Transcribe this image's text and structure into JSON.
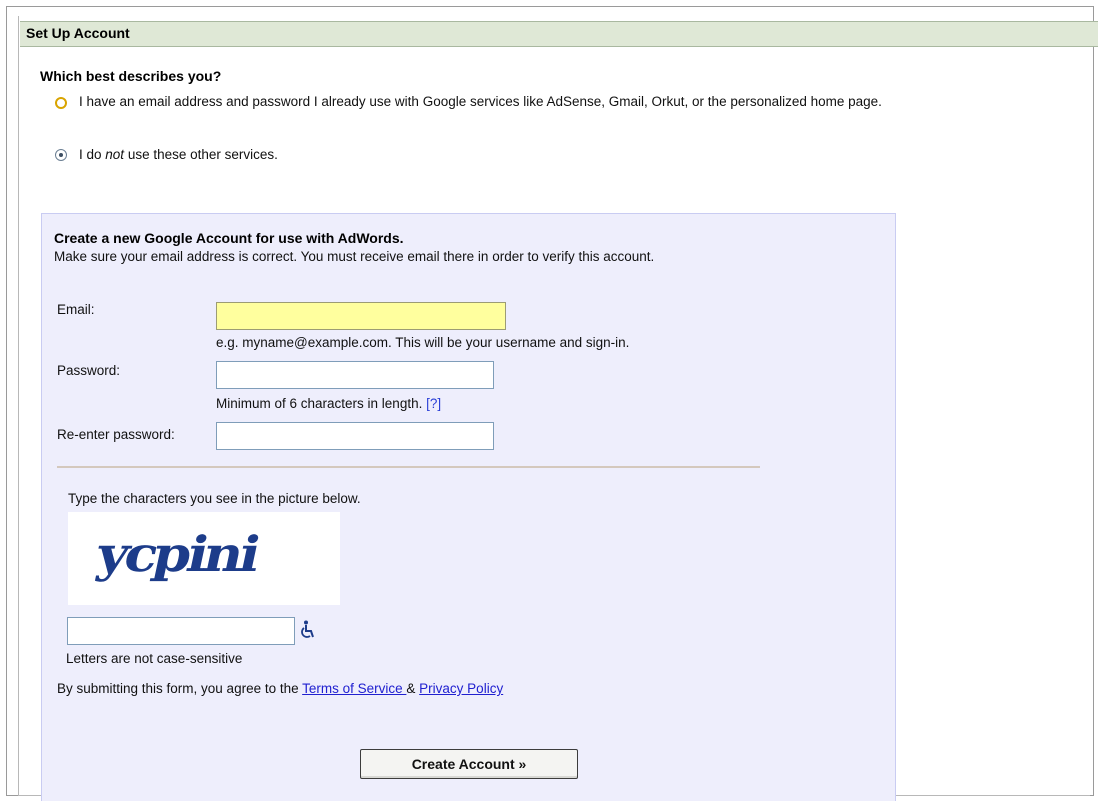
{
  "header": {
    "title": "Set Up Account"
  },
  "question": {
    "title": "Which best describes you?",
    "option_1": "I have an email address and password I already use with Google services like AdSense, Gmail, Orkut, or the personalized home page.",
    "option_2_prefix": "I do ",
    "option_2_em": "not",
    "option_2_suffix": " use these other services."
  },
  "form": {
    "title": "Create a new Google Account for use with AdWords.",
    "subtitle": "Make sure your email address is correct. You must receive email there in order to verify this account.",
    "email_label": "Email:",
    "email_value": "",
    "email_hint": "e.g. myname@example.com. This will be your username and sign-in.",
    "password_label": "Password:",
    "password_value": "",
    "password_hint": "Minimum of 6 characters in length.",
    "password_help_link": "[?]",
    "reenter_label": "Re-enter password:",
    "reenter_value": ""
  },
  "captcha": {
    "instruction": "Type the characters you see in the picture below.",
    "word": "ycpini",
    "input_value": "",
    "case_note": "Letters are not case-sensitive",
    "accessibility_icon": "wheelchair-icon"
  },
  "agreement": {
    "prefix": "By submitting this form, you agree to the ",
    "terms_link": "Terms of Service ",
    "separator": " & ",
    "privacy_link": "Privacy Policy"
  },
  "submit": {
    "label": "Create Account »"
  },
  "colors": {
    "header_bg": "#dfe8d6",
    "panel_bg": "#eeeefc",
    "link": "#2020d0",
    "email_field_bg": "#ffff9e",
    "captcha_text": "#1d3c8a"
  }
}
